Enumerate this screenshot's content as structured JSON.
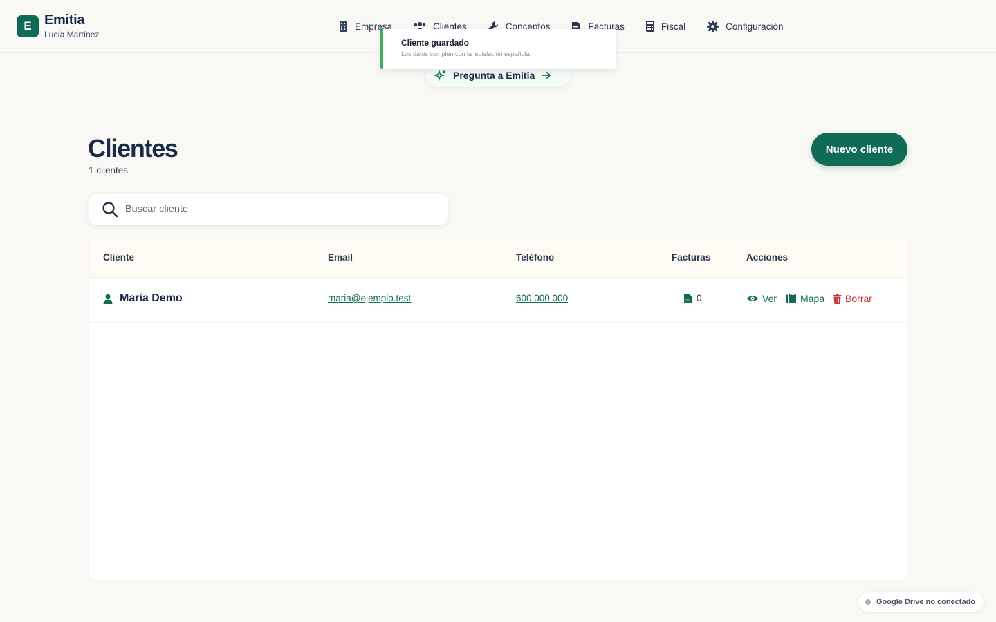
{
  "brand": {
    "logo_letter": "E",
    "name": "Emitia",
    "user": "Lucía Martínez",
    "accent": "#0f6b55"
  },
  "nav": {
    "items": [
      {
        "label": "Empresa",
        "icon": "building-icon"
      },
      {
        "label": "Clientes",
        "icon": "users-icon"
      },
      {
        "label": "Conceptos",
        "icon": "wrench-icon"
      },
      {
        "label": "Facturas",
        "icon": "invoice-icon"
      },
      {
        "label": "Fiscal",
        "icon": "calculator-icon"
      },
      {
        "label": "Configuración",
        "icon": "gear-icon"
      }
    ],
    "active": "Clientes"
  },
  "toast": {
    "title": "Cliente guardado",
    "message": "Los datos cumplen con la legislación española.",
    "status_color": "#3fae5f"
  },
  "ask": {
    "label": "Pregunta a Emitia"
  },
  "page": {
    "title": "Clientes",
    "count": "1 clientes",
    "new_button": "Nuevo cliente"
  },
  "search": {
    "placeholder": "Buscar cliente",
    "value": ""
  },
  "table": {
    "headers": [
      "Cliente",
      "Email",
      "Teléfono",
      "Facturas",
      "Acciones"
    ],
    "rows": [
      {
        "name": "María Demo",
        "email": "maria@ejemplo.test",
        "phone": "600 000 000",
        "invoices": "0",
        "actions": {
          "view": "Ver",
          "map": "Mapa",
          "delete": "Borrar"
        }
      }
    ]
  },
  "drive_status": {
    "label": "Google Drive no conectado"
  }
}
